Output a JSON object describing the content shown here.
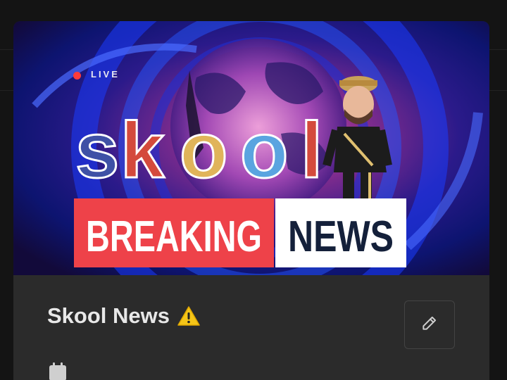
{
  "banner": {
    "live_label": "LIVE",
    "brand_word": "skool",
    "brand_letters": [
      "s",
      "k",
      "o",
      "o",
      "l"
    ],
    "brand_colors": [
      "#3f51a6",
      "#d44a3c",
      "#e0b45a",
      "#5aa4e0",
      "#d44a3c"
    ],
    "breaking_label": "BREAKING",
    "news_label": "NEWS",
    "breaking_color": "#ee4249",
    "news_text_color": "#14203a"
  },
  "group": {
    "name": "Skool News",
    "warning_icon": "warning-icon",
    "edit_icon": "pencil-icon"
  },
  "meta": {
    "icon": "calendar-icon"
  }
}
